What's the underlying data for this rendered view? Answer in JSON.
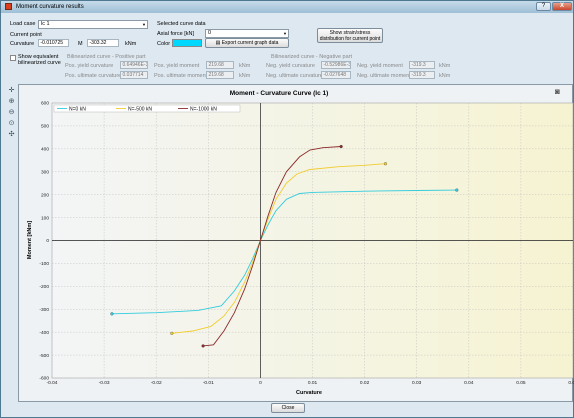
{
  "window": {
    "title": "Moment curvature results",
    "help_label": "?",
    "close_label": "X"
  },
  "controls": {
    "load_case_label": "Load case",
    "load_case_value": "lc 1",
    "current_point_label": "Current point",
    "curvature_label": "Curvature",
    "curvature_value": "-0.010725",
    "moment_label": "M",
    "moment_value": "-303.32",
    "moment_unit": "kNm",
    "selected_curve_label": "Selected curve data",
    "axial_force_label": "Axial force [kN]",
    "axial_force_value": "0",
    "color_label": "Color",
    "color_value": "#00d8ff",
    "export_button_label": "Export current graph data",
    "show_dist_button_line1": "Show strain/stress",
    "show_dist_button_line2": "distribution for current point",
    "show_bilinearized_line1": "Show equivalent",
    "show_bilinearized_line2": "bilinearized curve",
    "bilin_pos_title": "Bilinearized curve - Positive part",
    "bilin_neg_title": "Bilinearized curve - Negative part",
    "pos_yield_curv_label": "Pos. yield curvature",
    "pos_yield_curv_value": "0.64946E-3",
    "pos_ult_curv_label": "Pos. ultimate curvature",
    "pos_ult_curv_value": "0.037714",
    "pos_yield_moment_label": "Pos. yield moment",
    "pos_yield_moment_value": "219.68",
    "pos_ult_moment_label": "Pos. ultimate moment",
    "pos_ult_moment_value": "219.68",
    "kNm_unit": "kNm",
    "neg_yield_curv_label": "Neg. yield curvature",
    "neg_yield_curv_value": "-0.52986E-3",
    "neg_ult_curv_label": "Neg. ultimate curvature",
    "neg_ult_curv_value": "-0.027648",
    "neg_yield_moment_label": "Neg. yield moment",
    "neg_yield_moment_value": "-319.3",
    "neg_ult_moment_label": "Neg. ultimate moment",
    "neg_ult_moment_value": "-319.3",
    "close_button_label": "Close"
  },
  "toolbar": {
    "icons": [
      "crosshair-icon",
      "zoom-in-icon",
      "zoom-out-icon",
      "zoom-fit-icon",
      "pan-icon"
    ]
  },
  "chart_data": {
    "type": "line",
    "title": "Moment - Curvature Curve (lc 1)",
    "xlabel": "Curvature",
    "ylabel": "Moment [kNm]",
    "xlim": [
      -0.04,
      0.06
    ],
    "ylim": [
      -600,
      600
    ],
    "xticks": [
      -0.04,
      -0.03,
      -0.02,
      -0.01,
      0,
      0.01,
      0.02,
      0.03,
      0.04,
      0.05,
      0.06
    ],
    "yticks": [
      -600,
      -500,
      -400,
      -300,
      -200,
      -100,
      0,
      100,
      200,
      300,
      400,
      500,
      600
    ],
    "grid": true,
    "legend_position": "top-left",
    "series": [
      {
        "name": "N=0 kN",
        "color": "#33ccdd",
        "x": [
          -0.0285,
          -0.02,
          -0.012,
          -0.0075,
          -0.005,
          -0.003,
          -0.0015,
          0,
          0.0015,
          0.003,
          0.005,
          0.0075,
          0.01,
          0.02,
          0.03,
          0.0377
        ],
        "y": [
          -320,
          -315,
          -305,
          -285,
          -220,
          -150,
          -80,
          0,
          70,
          130,
          180,
          205,
          210,
          215,
          218,
          220
        ]
      },
      {
        "name": "N=-500 kN",
        "color": "#f0cc30",
        "x": [
          -0.017,
          -0.013,
          -0.0095,
          -0.007,
          -0.005,
          -0.003,
          -0.0015,
          0,
          0.0015,
          0.003,
          0.005,
          0.007,
          0.0095,
          0.015,
          0.02,
          0.024
        ],
        "y": [
          -405,
          -395,
          -375,
          -330,
          -270,
          -180,
          -95,
          0,
          95,
          180,
          250,
          290,
          310,
          322,
          328,
          335
        ]
      },
      {
        "name": "N=-1000 kN",
        "color": "#8b2a2a",
        "x": [
          -0.011,
          -0.009,
          -0.007,
          -0.005,
          -0.003,
          -0.0015,
          0,
          0.0015,
          0.003,
          0.005,
          0.0075,
          0.0095,
          0.012,
          0.0155
        ],
        "y": [
          -460,
          -455,
          -395,
          -315,
          -210,
          -110,
          0,
          110,
          210,
          300,
          365,
          395,
          405,
          410
        ]
      }
    ]
  }
}
